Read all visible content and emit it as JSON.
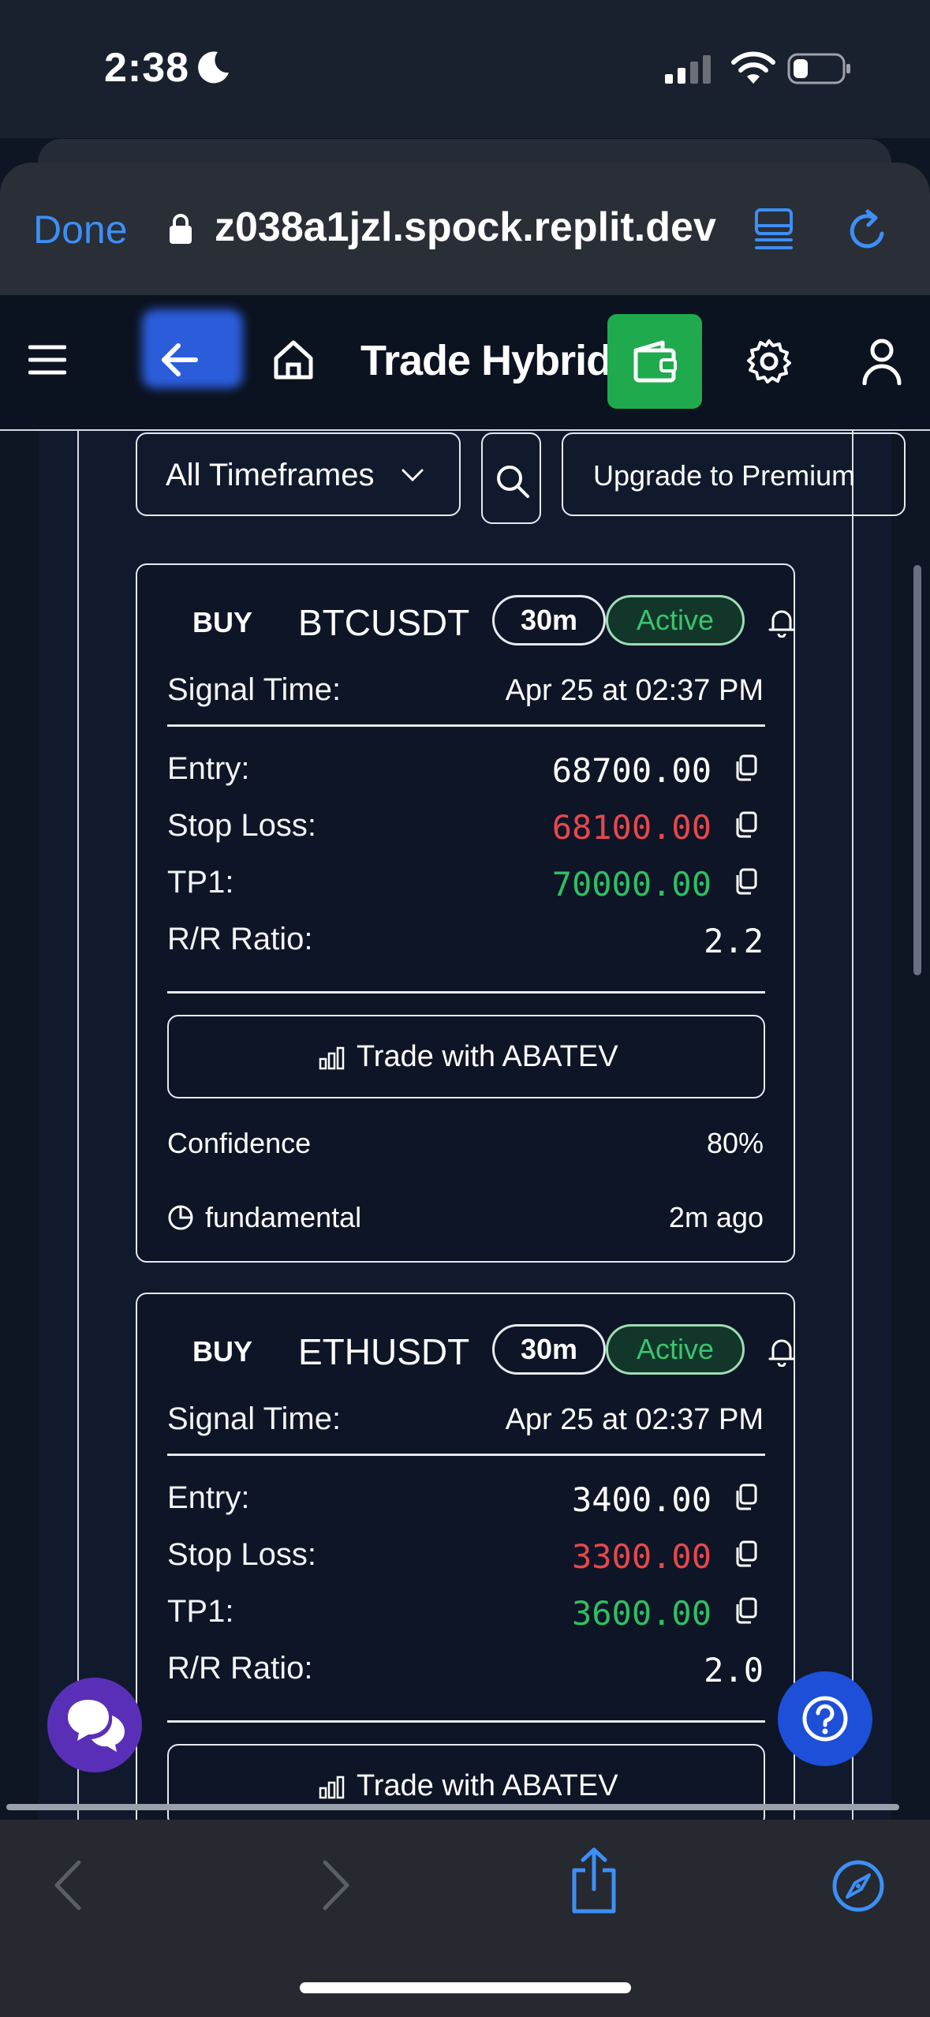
{
  "status_bar": {
    "time": "2:38"
  },
  "browser": {
    "done_label": "Done",
    "url": "z038a1jzl.spock.replit.dev"
  },
  "app": {
    "title": "Trade Hybrid"
  },
  "filters": {
    "timeframe_label": "All Timeframes",
    "premium_label": "Upgrade to Premium"
  },
  "signals": [
    {
      "side": "BUY",
      "symbol": "BTCUSDT",
      "timeframe": "30m",
      "status": "Active",
      "signal_time_label": "Signal Time:",
      "signal_time": "Apr 25 at 02:37 PM",
      "entry_label": "Entry:",
      "entry": "68700.00",
      "stop_label": "Stop Loss:",
      "stop_loss": "68100.00",
      "tp1_label": "TP1:",
      "tp1": "70000.00",
      "rr_label": "R/R Ratio:",
      "rr": "2.2",
      "trade_label": "Trade with ABATEV",
      "confidence_label": "Confidence",
      "confidence": "80%",
      "strategy": "fundamental",
      "ago": "2m ago"
    },
    {
      "side": "BUY",
      "symbol": "ETHUSDT",
      "timeframe": "30m",
      "status": "Active",
      "signal_time_label": "Signal Time:",
      "signal_time": "Apr 25 at 02:37 PM",
      "entry_label": "Entry:",
      "entry": "3400.00",
      "stop_label": "Stop Loss:",
      "stop_loss": "3300.00",
      "tp1_label": "TP1:",
      "tp1": "3600.00",
      "rr_label": "R/R Ratio:",
      "rr": "2.0",
      "trade_label": "Trade with ABATEV"
    }
  ],
  "colors": {
    "accent_blue": "#3d8ff5",
    "wallet_green": "#1faa4e",
    "stop_red": "#e5484d",
    "tp_green": "#2fbf63",
    "chat_purple": "#5a2fb8",
    "help_blue": "#1d4fd8"
  },
  "icons": [
    "moon-icon",
    "signal-icon",
    "wifi-icon",
    "battery-icon",
    "lock-icon",
    "reader-icon",
    "reload-icon",
    "menu-icon",
    "back-arrow-icon",
    "home-icon",
    "wallet-icon",
    "gear-icon",
    "user-icon",
    "chevron-down-icon",
    "search-icon",
    "bell-icon",
    "copy-icon",
    "bar-chart-icon",
    "clock-icon",
    "chat-icon",
    "help-icon",
    "nav-back-icon",
    "nav-forward-icon",
    "share-icon",
    "compass-icon"
  ]
}
